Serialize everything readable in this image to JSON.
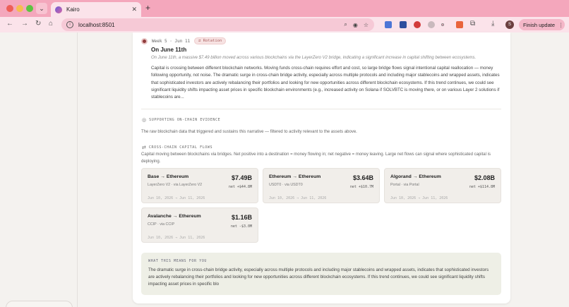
{
  "browser": {
    "tab_title": "Kairo",
    "tab_close": "✕",
    "new_tab": "+",
    "tab_menu": "⌄",
    "url": "localhost:8501",
    "finish_update": "Finish update",
    "profile_initial": "S"
  },
  "story": {
    "week": "Week 5 · Jun 11",
    "badge": "⇄ Rotation",
    "title": "On June 11th",
    "italic": "On June 11th, a massive $7.49 billion moved across various blockchains via the LayerZero V2 bridge, indicating a significant increase in capital shifting between ecosystems.",
    "body": "Capital is crossing between different blockchain networks. Moving funds cross-chain requires effort and cost, so large bridge flows signal intentional capital reallocation — money following opportunity, not noise. The dramatic surge in cross-chain bridge activity, especially across multiple protocols and including major stablecoins and wrapped assets, indicates that sophisticated investors are actively rebalancing their portfolios and looking for new opportunities across different blockchain ecosystems. If this trend continues, we could see significant liquidity shifts impacting asset prices in specific blockchain environments (e.g., increased activity on Solana if SOLVBTC is moving there, or on various Layer 2 solutions if stablecoins are..."
  },
  "evidence": {
    "label": "SUPPORTING ON-CHAIN EVIDENCE",
    "desc": "The raw blockchain data that triggered and sustains this narrative — filtered to activity relevant to the assets above."
  },
  "flows": {
    "label": "CROSS-CHAIN CAPITAL FLOWS",
    "desc": "Capital moving between blockchains via bridges. Net positive into a destination = money flowing in; net negative = money leaving. Large net flows can signal where sophisticated capital is deploying.",
    "items": [
      {
        "name": "Base → Ethereum",
        "via": "LayerZero V2 · via LayerZero V2",
        "amount": "$7.49B",
        "net": "net +$44.8M",
        "dates": "Jun 10, 2026 → Jun 11, 2026"
      },
      {
        "name": "Ethereum → Ethereum",
        "via": "USDT0 · via USDT0",
        "amount": "$3.64B",
        "net": "net +$10.7M",
        "dates": "Jun 10, 2026 → Jun 11, 2026"
      },
      {
        "name": "Algorand → Ethereum",
        "via": "Portal · via Portal",
        "amount": "$2.08B",
        "net": "net +$114.8M",
        "dates": "Jun 10, 2026 → Jun 11, 2026"
      },
      {
        "name": "Avalanche → Ethereum",
        "via": "CCIP · via CCIP",
        "amount": "$1.16B",
        "net": "net -$3.0M",
        "dates": "Jun 10, 2026 → Jun 11, 2026"
      }
    ]
  },
  "meaning": {
    "label": "WHAT THIS MEANS FOR YOU",
    "body": "The dramatic surge in cross-chain bridge activity, especially across multiple protocols and including major stablecoins and wrapped assets, indicates that sophisticated investors are actively rebalancing their portfolios and looking for new opportunities across different blockchain ecosystems. If this trend continues, we could see significant liquidity shifts impacting asset prices in specific blo"
  }
}
